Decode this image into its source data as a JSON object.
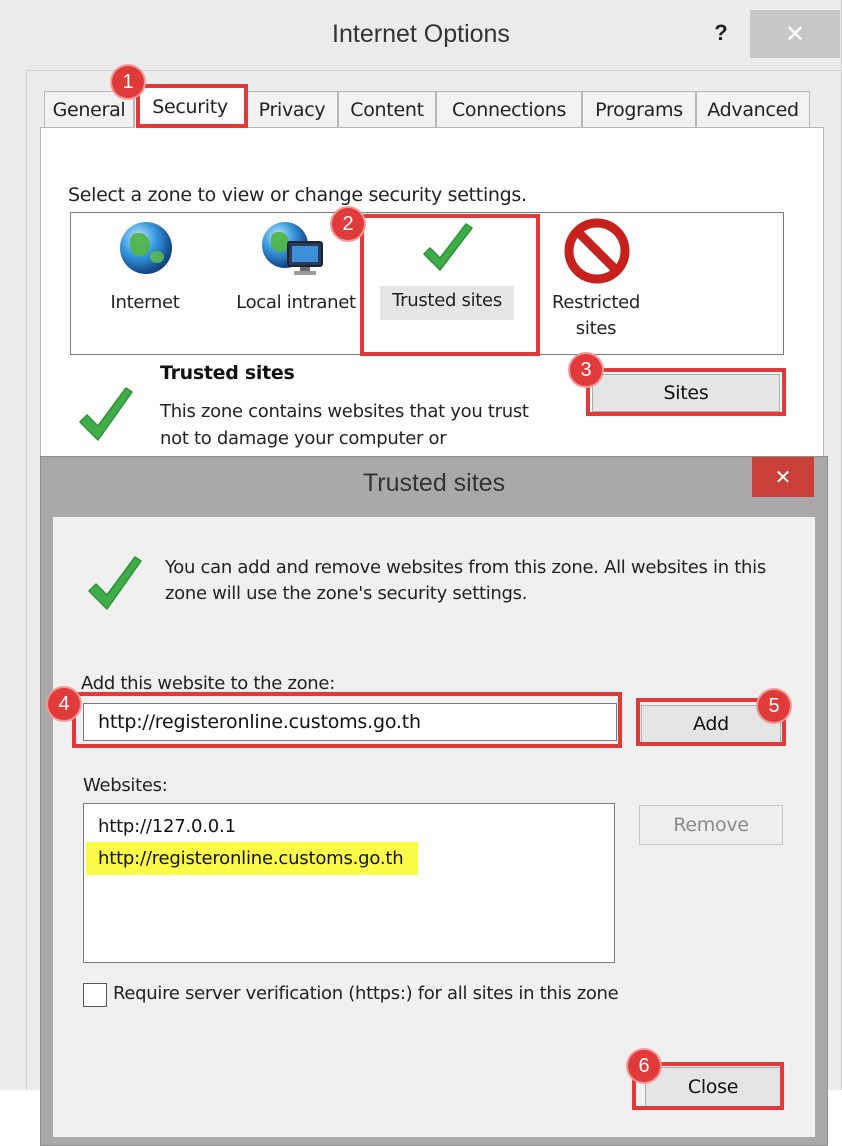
{
  "internet_options": {
    "title": "Internet Options",
    "help_symbol": "?",
    "close_symbol": "✕",
    "tabs": [
      {
        "label": "General"
      },
      {
        "label": "Security"
      },
      {
        "label": "Privacy"
      },
      {
        "label": "Content"
      },
      {
        "label": "Connections"
      },
      {
        "label": "Programs"
      },
      {
        "label": "Advanced"
      }
    ],
    "active_tab": "Security",
    "zone_prompt": "Select a zone to view or change security settings.",
    "zones": [
      {
        "label": "Internet",
        "icon": "globe-icon"
      },
      {
        "label": "Local intranet",
        "icon": "globe-computer-icon"
      },
      {
        "label": "Trusted sites",
        "icon": "checkmark-icon"
      },
      {
        "label_line1": "Restricted",
        "label_line2": "sites",
        "icon": "no-entry-icon"
      }
    ],
    "selected_zone": "Trusted sites",
    "zone_heading": "Trusted sites",
    "zone_description": "This zone contains websites that you trust not to damage your computer or",
    "sites_button": "Sites"
  },
  "trusted_sites_dialog": {
    "title": "Trusted sites",
    "close_symbol": "✕",
    "intro": "You can add and remove websites from this zone. All websites in this zone will use the zone's security settings.",
    "add_label": "Add this website to the zone:",
    "add_input_value": "http://registeronline.customs.go.th",
    "add_button": "Add",
    "websites_label": "Websites:",
    "websites": [
      {
        "url": "http://127.0.0.1",
        "highlighted": false
      },
      {
        "url": "http://registeronline.customs.go.th",
        "highlighted": true
      }
    ],
    "remove_button": "Remove",
    "require_https_label": "Require server verification (https:) for all sites in this zone",
    "require_https_checked": false,
    "close_button": "Close"
  },
  "step_badges": [
    "1",
    "2",
    "3",
    "4",
    "5",
    "6"
  ],
  "colors": {
    "highlight_red": "#e03a3a",
    "list_highlight_yellow": "#fbfb4a",
    "check_green": "#3fae49",
    "dialog_close_red": "#c9403a"
  }
}
